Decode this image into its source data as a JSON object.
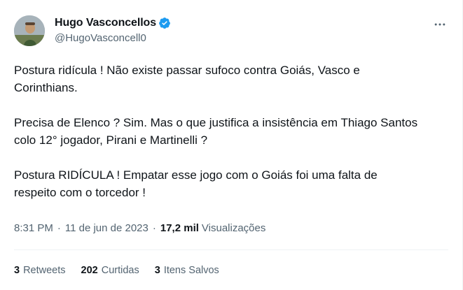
{
  "author": {
    "name": "Hugo Vasconcellos",
    "handle": "@HugoVasconcell0",
    "verified_icon": "verified-badge-icon",
    "verified_color": "#1d9bf0"
  },
  "more_icon": "more-horizontal-icon",
  "tweet": {
    "paragraphs": [
      "Postura ridícula ! Não existe passar sufoco contra Goiás, Vasco e\nCorinthians.",
      "Precisa de Elenco ? Sim. Mas o que justifica a insistência em Thiago Santos\ncolo 12° jogador, Pirani e Martinelli ?",
      "Postura RIDÍCULA ! Empatar esse jogo com o Goiás foi uma falta de\nrespeito com o torcedor !"
    ]
  },
  "meta": {
    "time": "8:31 PM",
    "separator": "·",
    "date": "11 de jun de 2023",
    "views_count": "17,2 mil",
    "views_label": "Visualizações"
  },
  "stats": {
    "retweets_count": "3",
    "retweets_label": "Retweets",
    "likes_count": "202",
    "likes_label": "Curtidas",
    "saves_count": "3",
    "saves_label": "Itens Salvos"
  },
  "colors": {
    "text": "#0f1419",
    "secondary": "#536471",
    "divider": "#eff3f4"
  }
}
